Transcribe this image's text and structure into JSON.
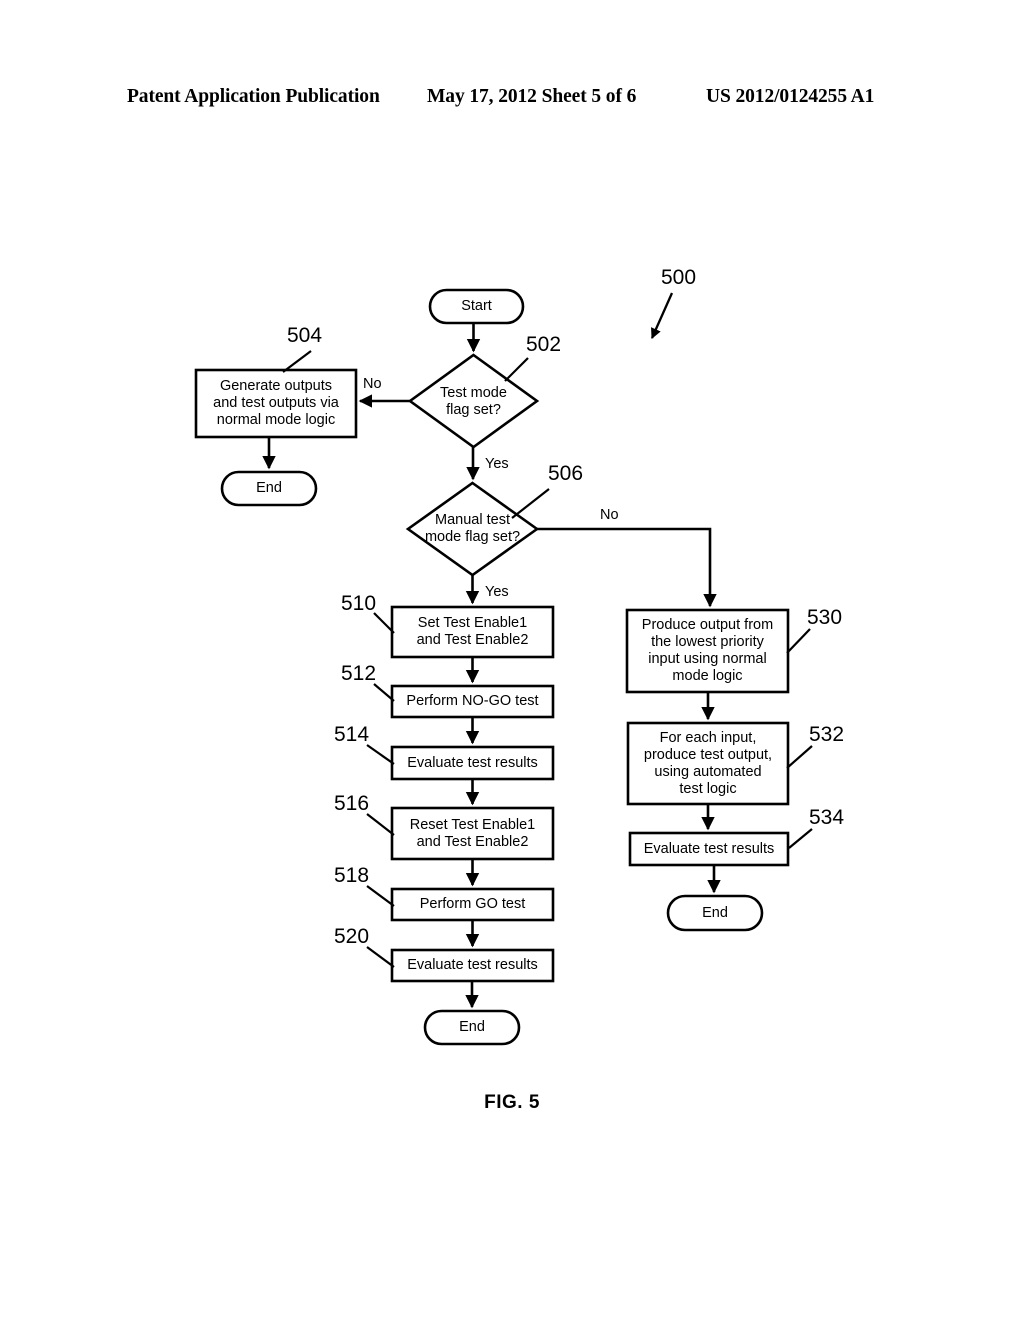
{
  "header": {
    "left": "Patent Application Publication",
    "middle": "May 17, 2012  Sheet 5 of 6",
    "right": "US 2012/0124255 A1"
  },
  "figure": {
    "caption": "FIG. 5",
    "diagram_ref": "500",
    "nodes": {
      "start": {
        "label": "Start"
      },
      "d502": {
        "label": "Test mode\nflag set?",
        "ref": "502"
      },
      "b504": {
        "label": "Generate outputs\nand test outputs via\nnormal mode logic",
        "ref": "504"
      },
      "end504": {
        "label": "End"
      },
      "d506": {
        "label": "Manual test\nmode flag set?",
        "ref": "506"
      },
      "b510": {
        "label": "Set Test Enable1\nand Test Enable2",
        "ref": "510"
      },
      "b512": {
        "label": "Perform NO-GO test",
        "ref": "512"
      },
      "b514": {
        "label": "Evaluate test results",
        "ref": "514"
      },
      "b516": {
        "label": "Reset Test Enable1\nand Test Enable2",
        "ref": "516"
      },
      "b518": {
        "label": "Perform GO test",
        "ref": "518"
      },
      "b520": {
        "label": "Evaluate test results",
        "ref": "520"
      },
      "end520": {
        "label": "End"
      },
      "b530": {
        "label": "Produce output from\nthe lowest priority\ninput using normal\nmode logic",
        "ref": "530"
      },
      "b532": {
        "label": "For each input,\nproduce test output,\nusing automated\ntest logic",
        "ref": "532"
      },
      "b534": {
        "label": "Evaluate test results",
        "ref": "534"
      },
      "end534": {
        "label": "End"
      }
    },
    "edge_labels": {
      "no_502": "No",
      "yes_502": "Yes",
      "no_506": "No",
      "yes_506": "Yes"
    }
  }
}
